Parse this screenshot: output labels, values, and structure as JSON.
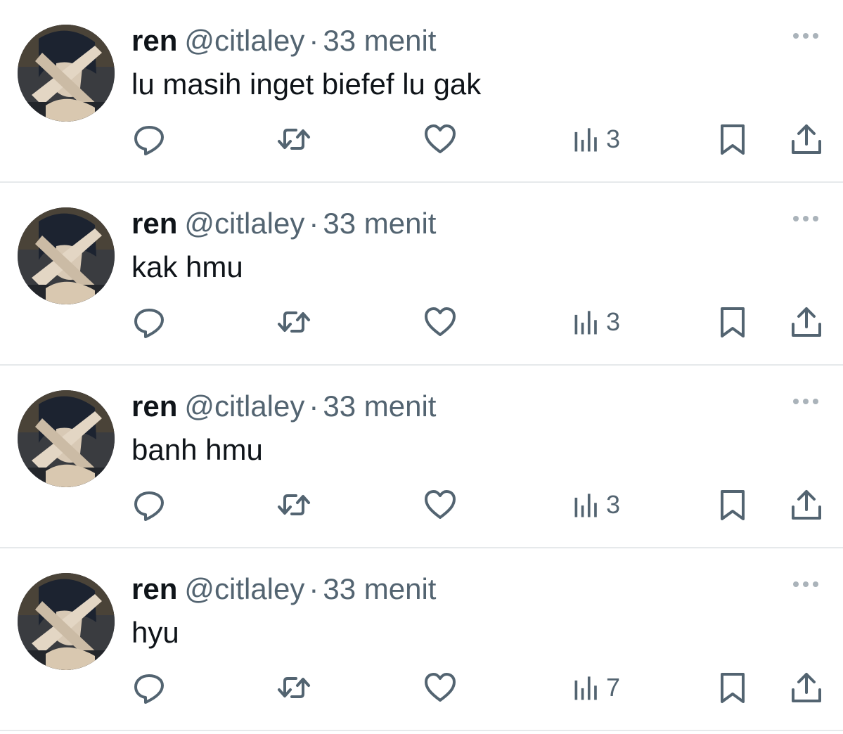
{
  "tweets": [
    {
      "author_name": "ren",
      "handle": "@citlaley",
      "separator": "·",
      "time": "33 menit",
      "text": "lu masih inget biefef lu gak",
      "views": "3"
    },
    {
      "author_name": "ren",
      "handle": "@citlaley",
      "separator": "·",
      "time": "33 menit",
      "text": "kak hmu",
      "views": "3"
    },
    {
      "author_name": "ren",
      "handle": "@citlaley",
      "separator": "·",
      "time": "33 menit",
      "text": "banh hmu",
      "views": "3"
    },
    {
      "author_name": "ren",
      "handle": "@citlaley",
      "separator": "·",
      "time": "33 menit",
      "text": "hyu",
      "views": "7"
    }
  ],
  "icons": {
    "more": "more-dots-icon",
    "reply": "reply-icon",
    "retweet": "retweet-icon",
    "like": "heart-icon",
    "views": "views-bar-chart-icon",
    "bookmark": "bookmark-icon",
    "share": "share-icon"
  },
  "colors": {
    "icon": "#536471",
    "text": "#0f1419",
    "secondary_text": "#536471",
    "divider": "#e6e9eb",
    "more_dots": "#aab3ba"
  }
}
